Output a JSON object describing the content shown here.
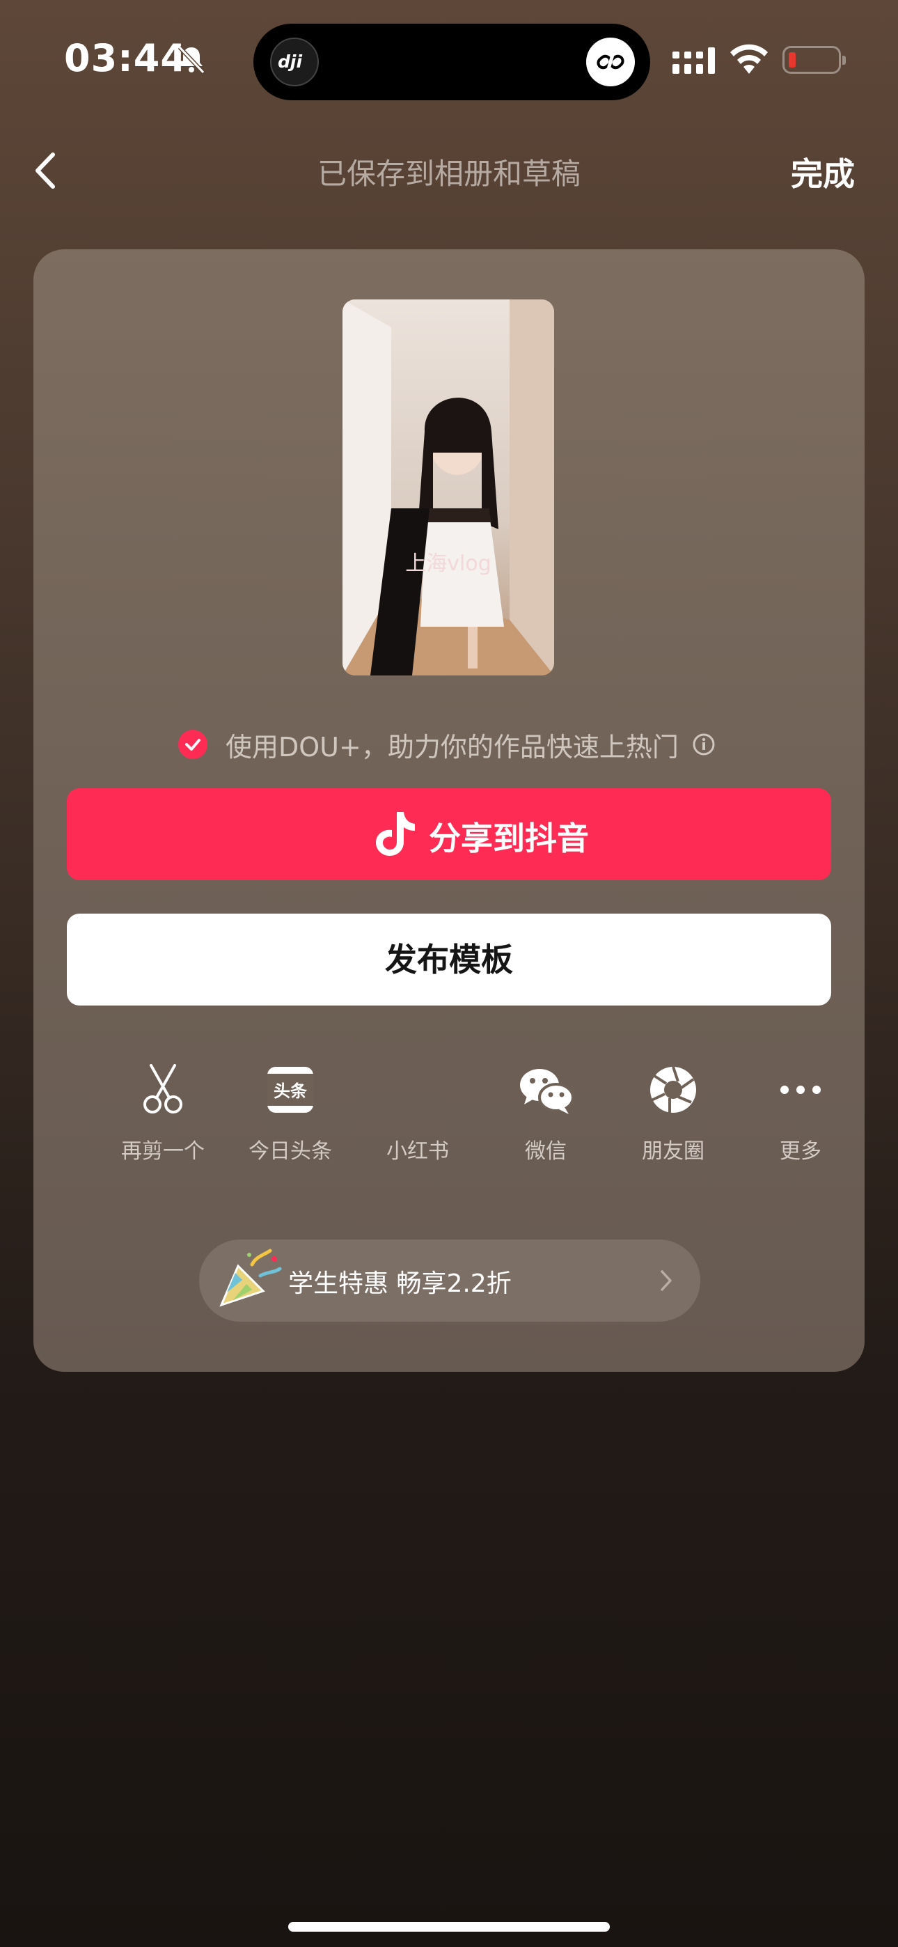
{
  "status_bar": {
    "time": "03:44"
  },
  "nav": {
    "title": "已保存到相册和草稿",
    "done_label": "完成"
  },
  "preview": {
    "caption": "上海vlog"
  },
  "dou_plus": {
    "text": "使用DOU+，助力你的作品快速上热门"
  },
  "buttons": {
    "share": "分享到抖音",
    "template": "发布模板"
  },
  "actions": [
    {
      "label": "再剪一个",
      "icon": "scissors-icon"
    },
    {
      "label": "今日头条",
      "icon": "toutiao-icon"
    },
    {
      "label": "小红书",
      "icon": "xiaohongshu-icon"
    },
    {
      "label": "微信",
      "icon": "wechat-icon"
    },
    {
      "label": "朋友圈",
      "icon": "moments-icon"
    },
    {
      "label": "更多",
      "icon": "more-icon"
    }
  ],
  "promo": {
    "text": "学生特惠 畅享2.2折"
  },
  "colors": {
    "accent": "#fe2c55",
    "battery_low": "#e8372f"
  }
}
